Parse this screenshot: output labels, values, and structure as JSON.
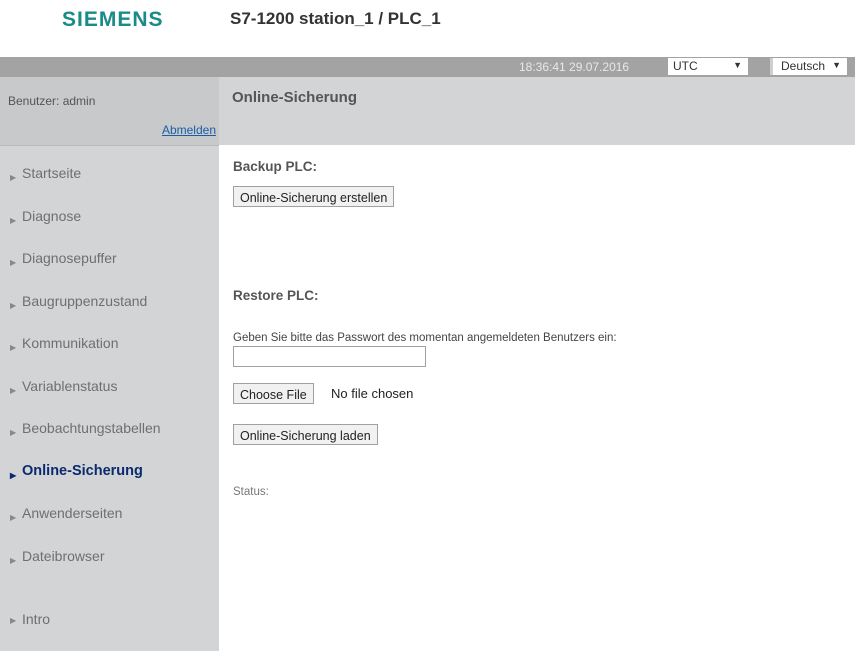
{
  "header": {
    "logo": "SIEMENS",
    "station": "S7-1200 station_1 / PLC_1"
  },
  "topbar": {
    "datetime": "18:36:41  29.07.2016",
    "timezone": "UTC",
    "language": "Deutsch"
  },
  "user": {
    "label": "Benutzer: admin",
    "logout": "Abmelden"
  },
  "nav": [
    {
      "label": "Startseite"
    },
    {
      "label": "Diagnose"
    },
    {
      "label": "Diagnosepuffer"
    },
    {
      "label": "Baugruppenzustand"
    },
    {
      "label": "Kommunikation"
    },
    {
      "label": "Variablenstatus"
    },
    {
      "label": "Beobachtungstabellen"
    },
    {
      "label": "Online-Sicherung",
      "active": true
    },
    {
      "label": "Anwenderseiten"
    },
    {
      "label": "Dateibrowser"
    }
  ],
  "nav_intro": "Intro",
  "page": {
    "title": "Online-Sicherung",
    "backup_heading": "Backup PLC:",
    "backup_button": "Online-Sicherung erstellen",
    "restore_heading": "Restore PLC:",
    "password_prompt": "Geben Sie bitte das Passwort des momentan angemeldeten Benutzers ein:",
    "password_value": "",
    "choose_file": "Choose File",
    "no_file": "No file chosen",
    "load_button": "Online-Sicherung laden",
    "status_label": "Status:"
  },
  "colors": {
    "logo": "#1a8a8a",
    "active_nav": "#0a2a6e",
    "sidebar": "#d2d4d6",
    "topbar": "#a3a3a3",
    "link": "#1a5ea6"
  }
}
